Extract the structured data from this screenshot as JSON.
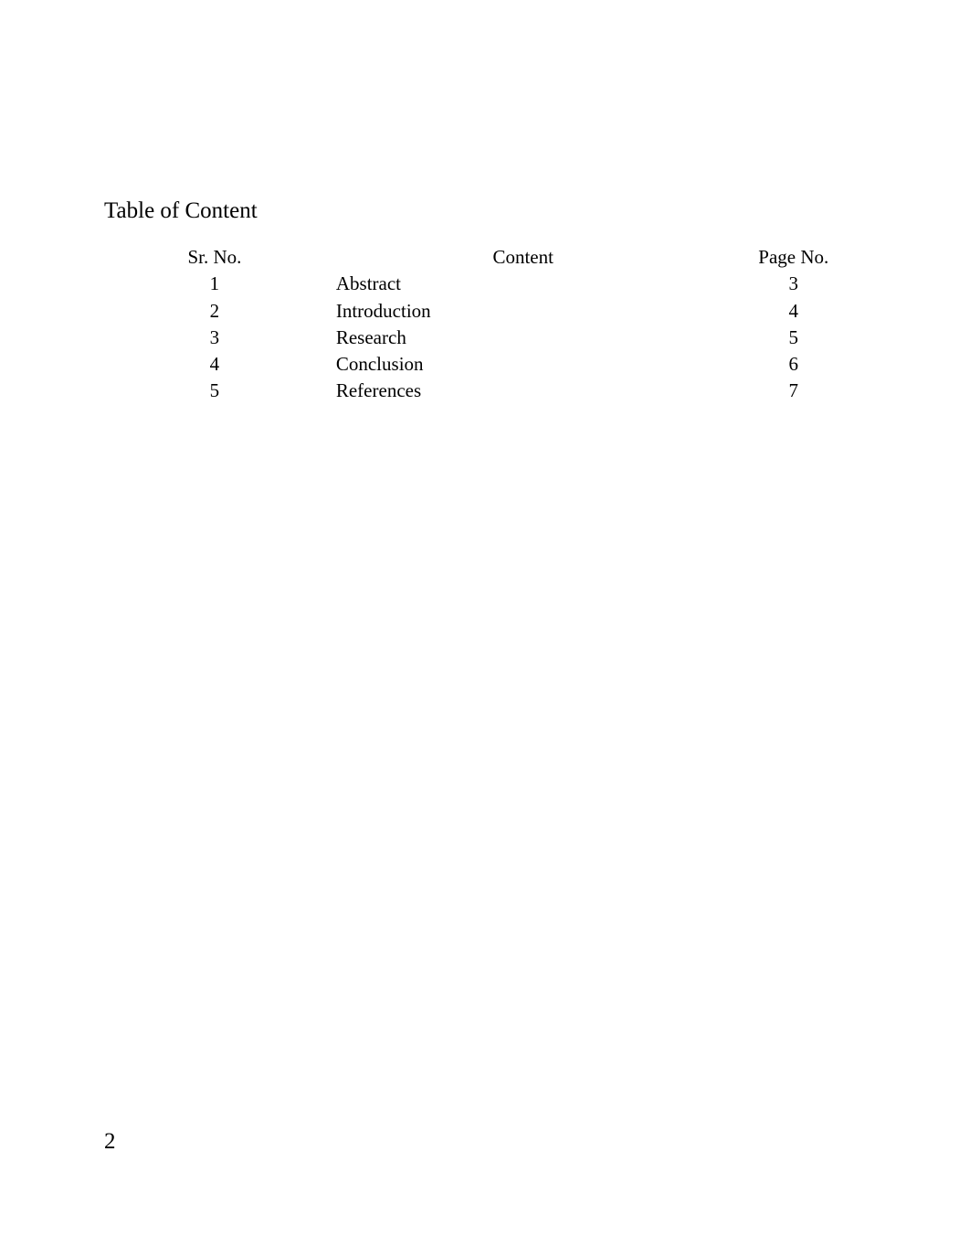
{
  "document": {
    "title": "Table of Content",
    "page_number": "2",
    "table": {
      "headers": {
        "sr_no": "Sr. No.",
        "content": "Content",
        "page_no": "Page No."
      },
      "rows": [
        {
          "sr_no": "1",
          "content": "Abstract",
          "page_no": "3"
        },
        {
          "sr_no": "2",
          "content": "Introduction",
          "page_no": "4"
        },
        {
          "sr_no": "3",
          "content": "Research",
          "page_no": "5"
        },
        {
          "sr_no": "4",
          "content": "Conclusion",
          "page_no": "6"
        },
        {
          "sr_no": "5",
          "content": "References",
          "page_no": "7"
        }
      ]
    }
  }
}
